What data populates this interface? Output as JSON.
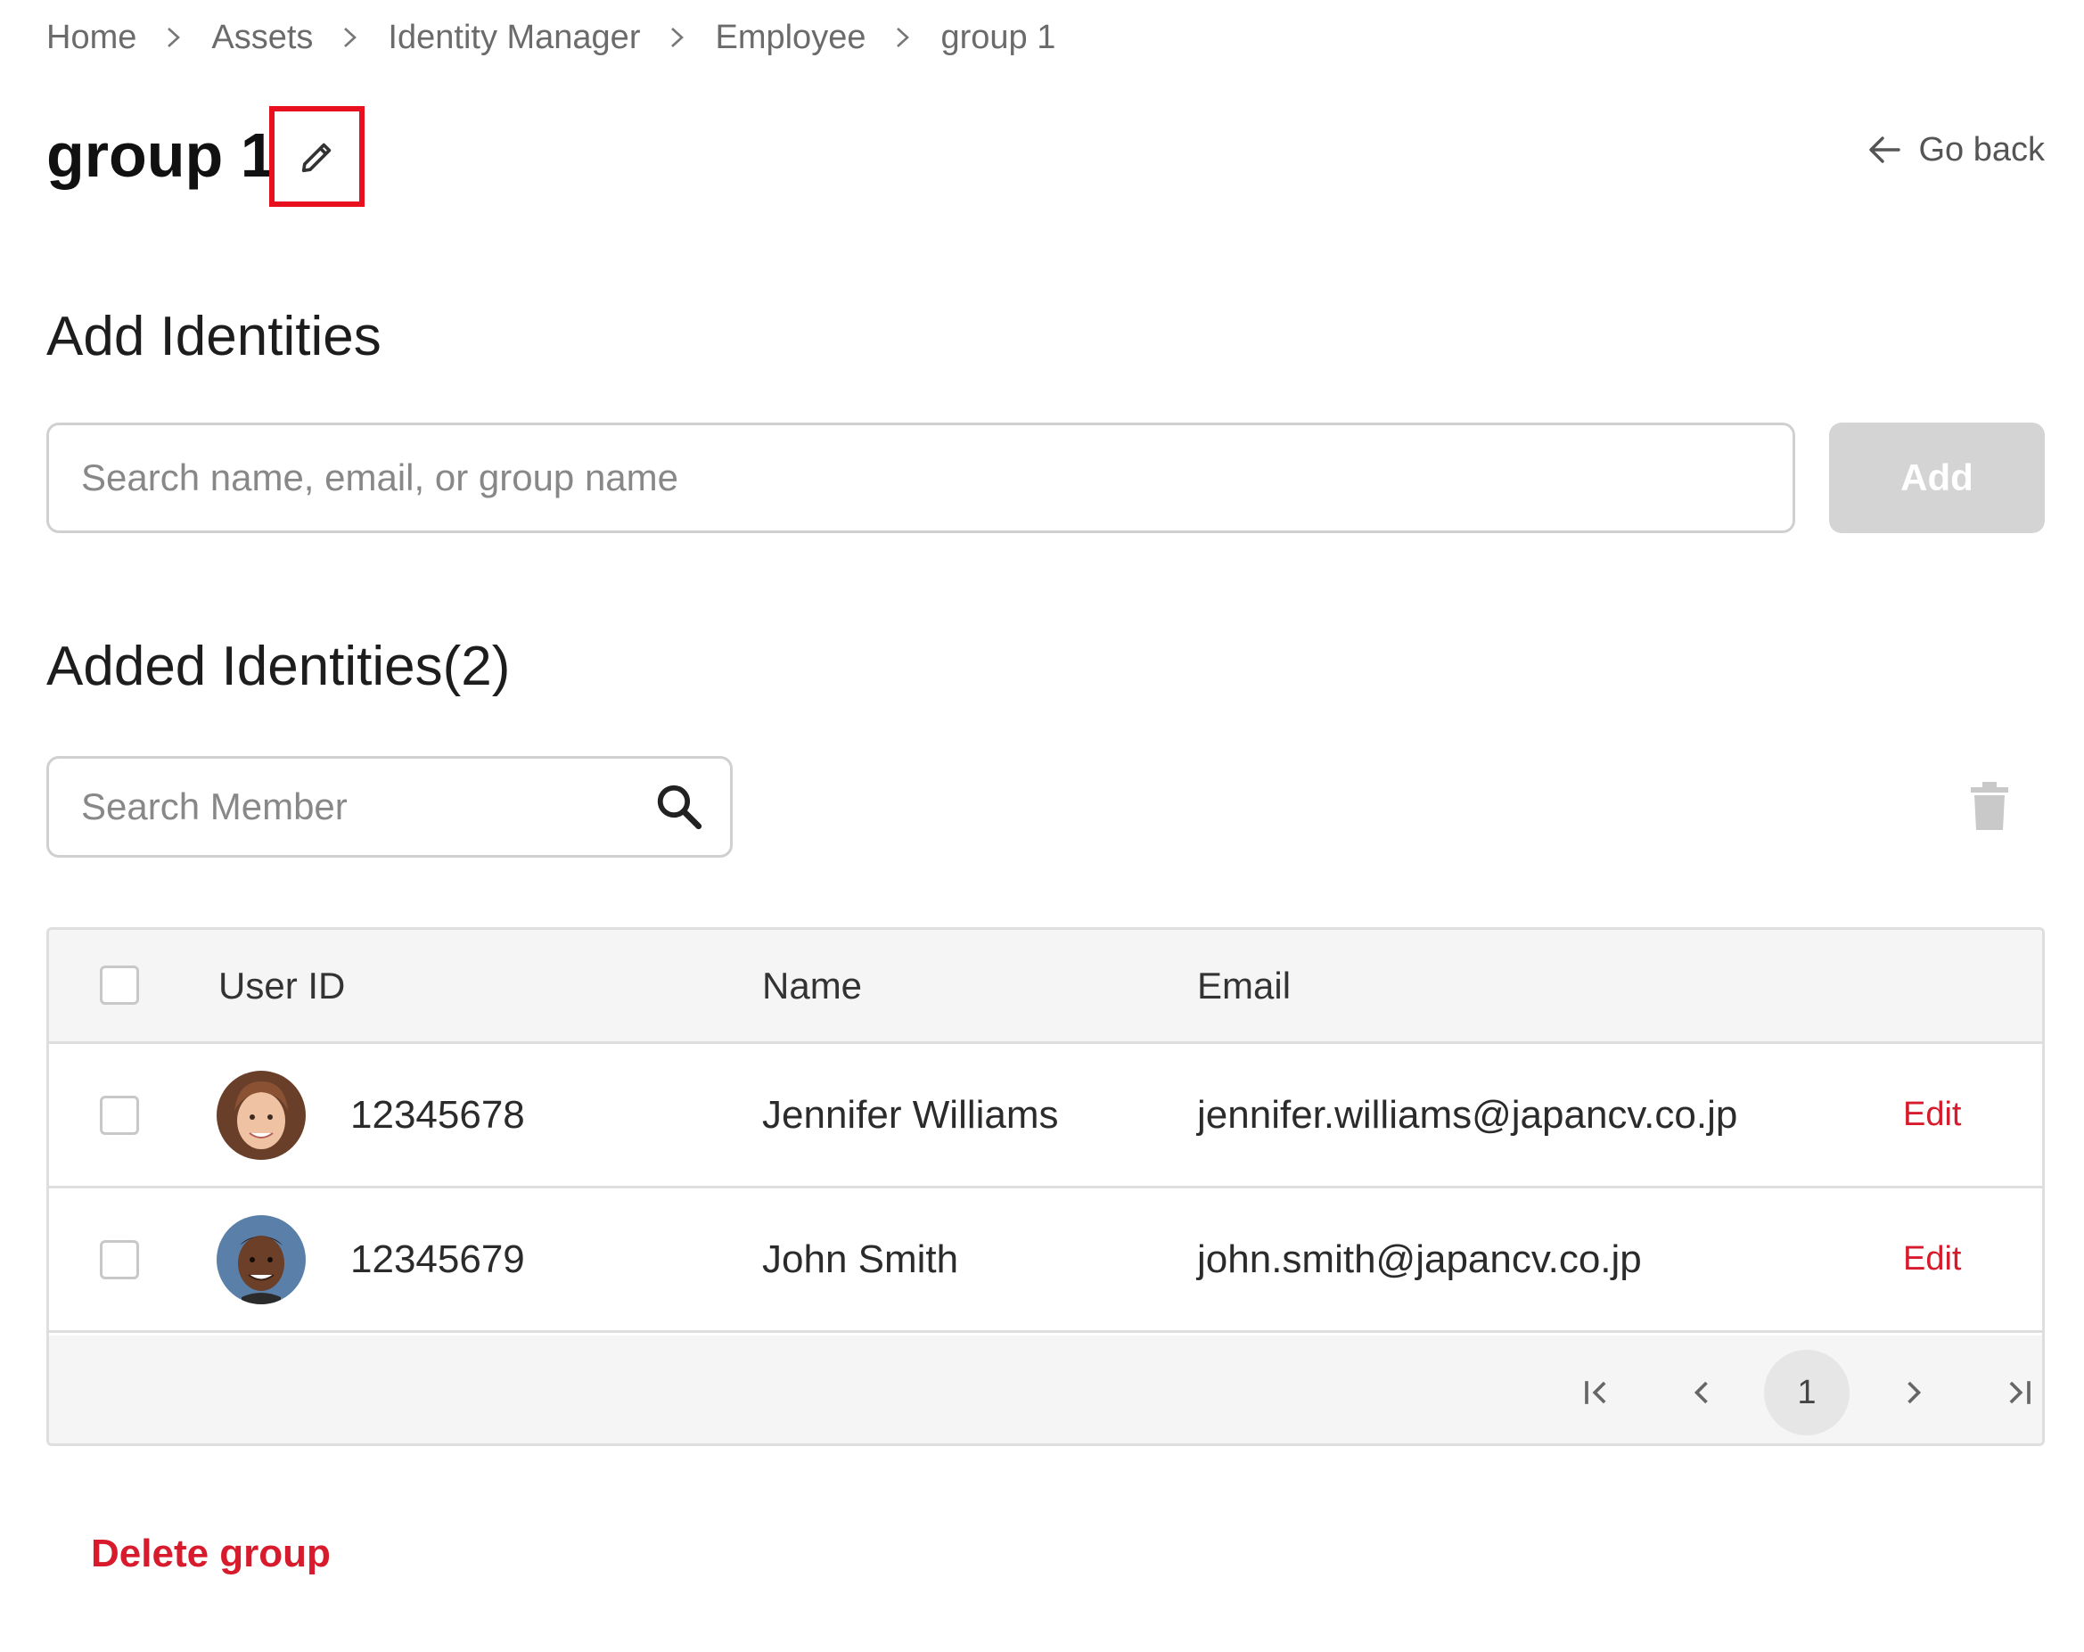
{
  "breadcrumb": {
    "items": [
      "Home",
      "Assets",
      "Identity Manager",
      "Employee",
      "group 1"
    ]
  },
  "header": {
    "title": "group 1",
    "edit_icon": "pencil-icon",
    "go_back_label": "Go back"
  },
  "add_identities": {
    "heading": "Add Identities",
    "search_placeholder": "Search name, email, or group name",
    "search_value": "",
    "add_label": "Add"
  },
  "added_identities": {
    "heading": "Added Identities(2)",
    "search_placeholder": "Search Member",
    "search_value": "",
    "delete_icon": "trash-icon",
    "columns": {
      "user_id": "User ID",
      "name": "Name",
      "email": "Email"
    },
    "rows": [
      {
        "user_id": "12345678",
        "name": "Jennifer Williams",
        "email": "jennifer.williams@japancv.co.jp",
        "action": "Edit"
      },
      {
        "user_id": "12345679",
        "name": "John Smith",
        "email": "john.smith@japancv.co.jp",
        "action": "Edit"
      }
    ],
    "pagination": {
      "current_page": "1"
    }
  },
  "footer": {
    "delete_group_label": "Delete group"
  },
  "colors": {
    "accent_red": "#d81b2c",
    "highlight_box": "#e8101e",
    "disabled_button": "#d4d4d4"
  }
}
